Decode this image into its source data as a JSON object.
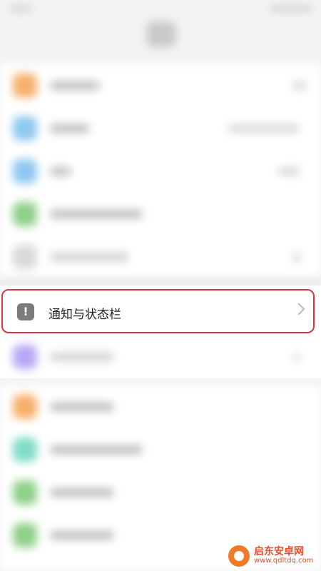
{
  "notification_row": {
    "label": "通知与状态栏",
    "icon": "exclamation-icon"
  },
  "watermark": {
    "title": "启东安卓网",
    "url": "www.qdltdq.com"
  },
  "colors": {
    "highlight_border": "#d8363f",
    "icon_bg": "#7b7b7b",
    "watermark": "#e64d2a"
  }
}
